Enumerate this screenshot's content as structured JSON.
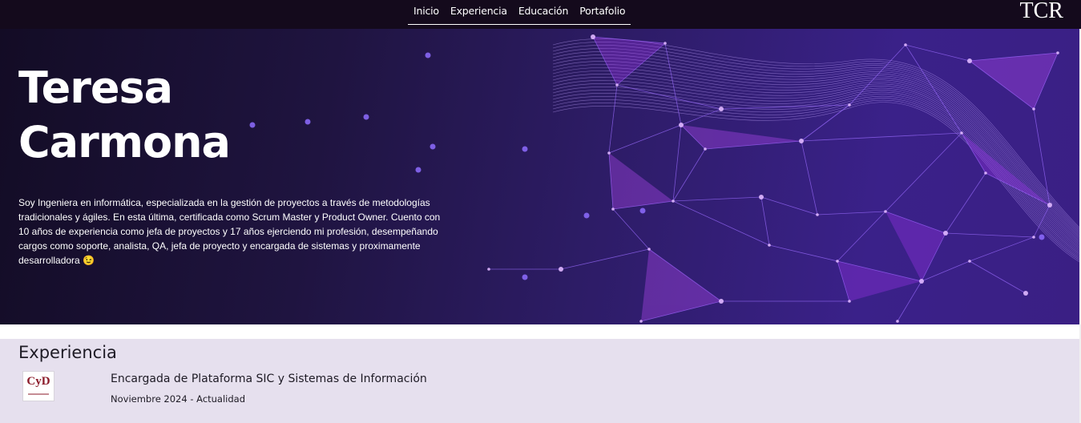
{
  "nav": {
    "links": [
      "Inicio",
      "Experiencia",
      "Educación",
      "Portafolio"
    ],
    "logo": "TCR",
    "background": "#140a1c"
  },
  "hero": {
    "name": "Teresa\nCarmona",
    "bio": "Soy Ingeniera en informática, especializada en la gestión de proyectos a través de metodologías tradicionales y ágiles. En esta última, certificada como Scrum Master y Product Owner. Cuento con 10 años de experiencia como jefa de proyectos y 17 años ejerciendo mi profesión, desempeñando cargos como soporte, analista, QA, jefa de proyecto y encargada de sistemas y proximamente desarrolladora 😉",
    "accent": "#c04dff"
  },
  "experience": {
    "title": "Experiencia",
    "items": [
      {
        "logo_text": "CyD",
        "role": "Encargada de Plataforma SIC y Sistemas de Información",
        "period": "Noviembre 2024 - Actualidad"
      }
    ]
  }
}
